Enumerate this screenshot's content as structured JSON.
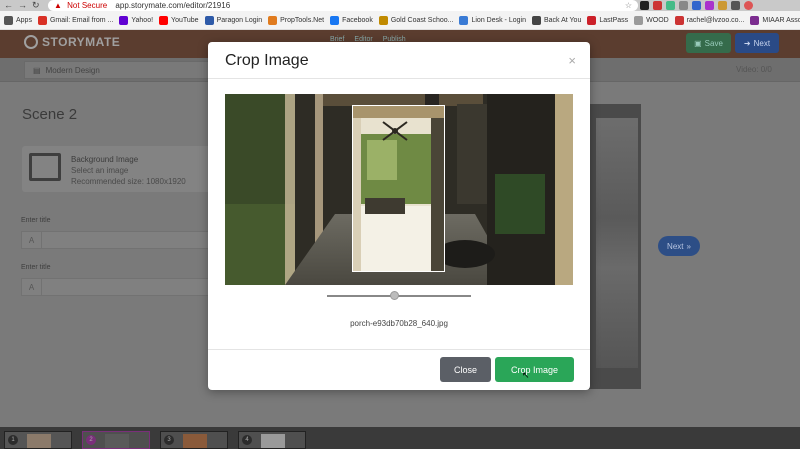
{
  "browser": {
    "security_label": "Not Secure",
    "url": "app.storymate.com/editor/21916",
    "bookmarks": [
      {
        "label": "Apps",
        "icon": "apps-grid-icon",
        "color": "#555555"
      },
      {
        "label": "Gmail: Email from ...",
        "icon": "gmail-icon",
        "color": "#d93025"
      },
      {
        "label": "Yahoo!",
        "icon": "yahoo-icon",
        "color": "#6001d2"
      },
      {
        "label": "YouTube",
        "icon": "youtube-icon",
        "color": "#ff0000"
      },
      {
        "label": "Paragon Login",
        "icon": "paragon-icon",
        "color": "#2e5aa8"
      },
      {
        "label": "PropTools.Net",
        "icon": "proptools-icon",
        "color": "#e07b1e"
      },
      {
        "label": "Facebook",
        "icon": "facebook-icon",
        "color": "#1877f2"
      },
      {
        "label": "Gold Coast Schoo...",
        "icon": "school-icon",
        "color": "#c08a00"
      },
      {
        "label": "Lion Desk - Login",
        "icon": "liondesk-icon",
        "color": "#3a7bd5"
      },
      {
        "label": "Back At You",
        "icon": "backatyou-icon",
        "color": "#444444"
      },
      {
        "label": "LastPass",
        "icon": "lastpass-icon",
        "color": "#cc2029"
      },
      {
        "label": "WOOD",
        "icon": "wood-icon",
        "color": "#9a9a9a"
      },
      {
        "label": "rachel@lvzoo.co...",
        "icon": "mail-icon",
        "color": "#cc3333"
      },
      {
        "label": "MIAAR Association...",
        "icon": "miaar-icon",
        "color": "#7b2c8f"
      }
    ]
  },
  "app": {
    "logo_text": "STORYMATE",
    "steps": [
      "Brief",
      "Editor",
      "Publish"
    ],
    "save_label": "Save",
    "next_label": "Next",
    "design_select": "Modern Design",
    "video_count": "Video: 0/0",
    "scene_title": "Scene 2",
    "background": {
      "title": "Background Image",
      "subtitle": "Select an image",
      "recommended": "Recommended size: 1080x1920"
    },
    "field1_label": "Enter title",
    "field2_label": "Enter title",
    "next_pill_label": "Next",
    "timeline": [
      "1",
      "2",
      "3",
      "4"
    ]
  },
  "modal": {
    "title": "Crop Image",
    "close_x": "×",
    "zoom_level": 0.47,
    "filename": "porch-e93db70b28_640.jpg",
    "close_label": "Close",
    "crop_label": "Crop Image"
  },
  "colors": {
    "crop_button": "#2aa658",
    "close_button": "#5b5f66",
    "save_button": "#356b4b",
    "next_button": "#2a4a86"
  }
}
